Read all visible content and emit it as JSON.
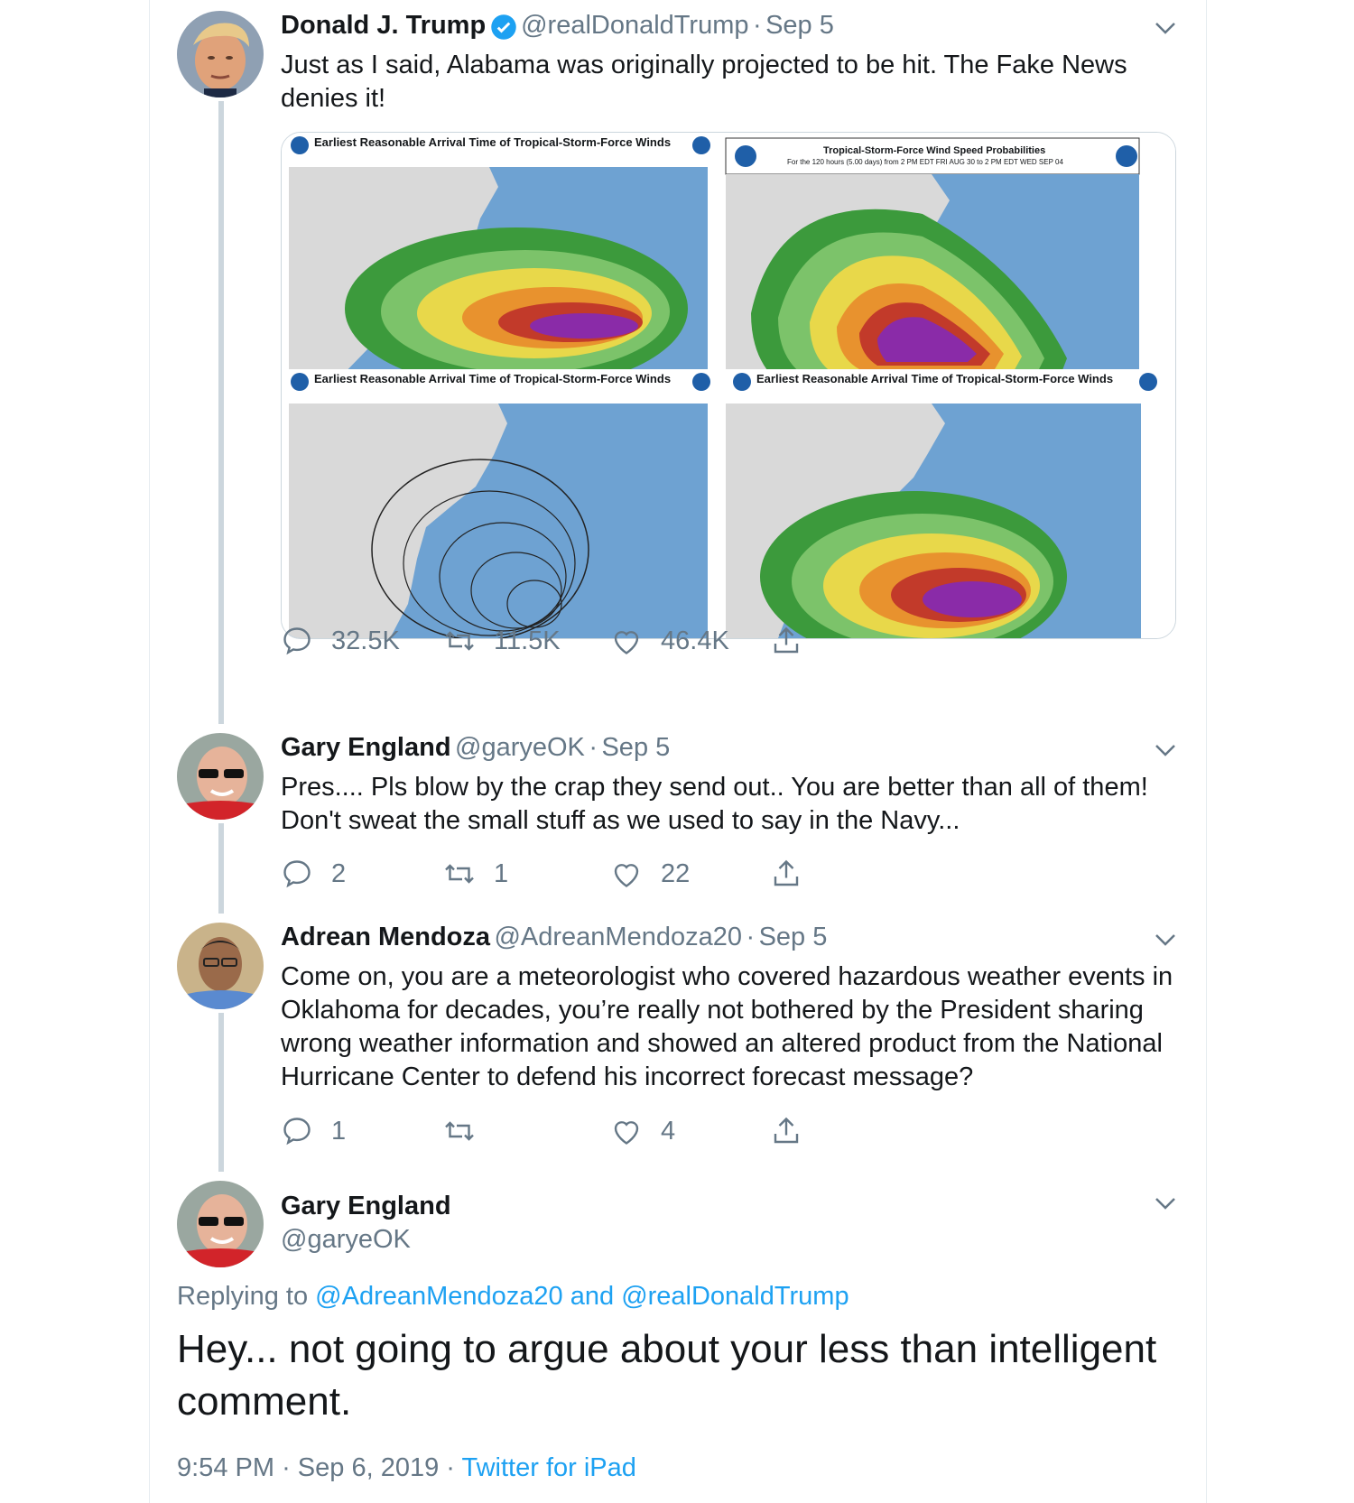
{
  "colors": {
    "link": "#1da1f2",
    "muted": "#657786",
    "verified": "#1da1f2"
  },
  "tweets": [
    {
      "name": "Donald J. Trump",
      "handle": "@realDonaldTrump",
      "sep": "·",
      "date": "Sep 5",
      "verified": true,
      "text": "Just as I said, Alabama was originally projected to be hit. The Fake News denies it!",
      "stats": {
        "replies": "32.5K",
        "retweets": "11.5K",
        "likes": "46.4K"
      },
      "media": {
        "panels": [
          {
            "title": "Earliest Reasonable Arrival Time of Tropical-Storm-Force Winds",
            "subtitle": ""
          },
          {
            "title": "Tropical-Storm-Force Wind Speed Probabilities",
            "subtitle": "For the 120 hours (5.00 days) from 2 PM EDT FRI AUG 30 to 2 PM EDT WED SEP 04"
          },
          {
            "title": "Earliest Reasonable Arrival Time of Tropical-Storm-Force Winds",
            "subtitle": ""
          },
          {
            "title": "Earliest Reasonable Arrival Time of Tropical-Storm-Force Winds",
            "subtitle": ""
          }
        ]
      }
    },
    {
      "name": "Gary England",
      "handle": "@garyeOK",
      "sep": "·",
      "date": "Sep 5",
      "text": "Pres.... Pls blow by the crap they send out..  You are better than all of them!  Don't sweat the small stuff as we used to say in the Navy...",
      "stats": {
        "replies": "2",
        "retweets": "1",
        "likes": "22"
      }
    },
    {
      "name": "Adrean Mendoza",
      "handle": "@AdreanMendoza20",
      "sep": "·",
      "date": "Sep 5",
      "text": "Come on, you are a meteorologist who covered hazardous weather events in Oklahoma for decades, you’re really not bothered by the President sharing wrong weather information and showed an altered product from the National Hurricane Center to defend his incorrect forecast message?",
      "stats": {
        "replies": "1",
        "retweets": "",
        "likes": "4"
      }
    }
  ],
  "focus": {
    "name": "Gary England",
    "handle": "@garyeOK",
    "replying_prefix": "Replying to",
    "replying_user1": "@AdreanMendoza20",
    "replying_and": "and",
    "replying_user2": "@realDonaldTrump",
    "text": "Hey... not going to argue about your less than intelligent comment.",
    "time": "9:54 PM",
    "sep": "·",
    "date": "Sep 6, 2019",
    "client": "Twitter for iPad"
  }
}
